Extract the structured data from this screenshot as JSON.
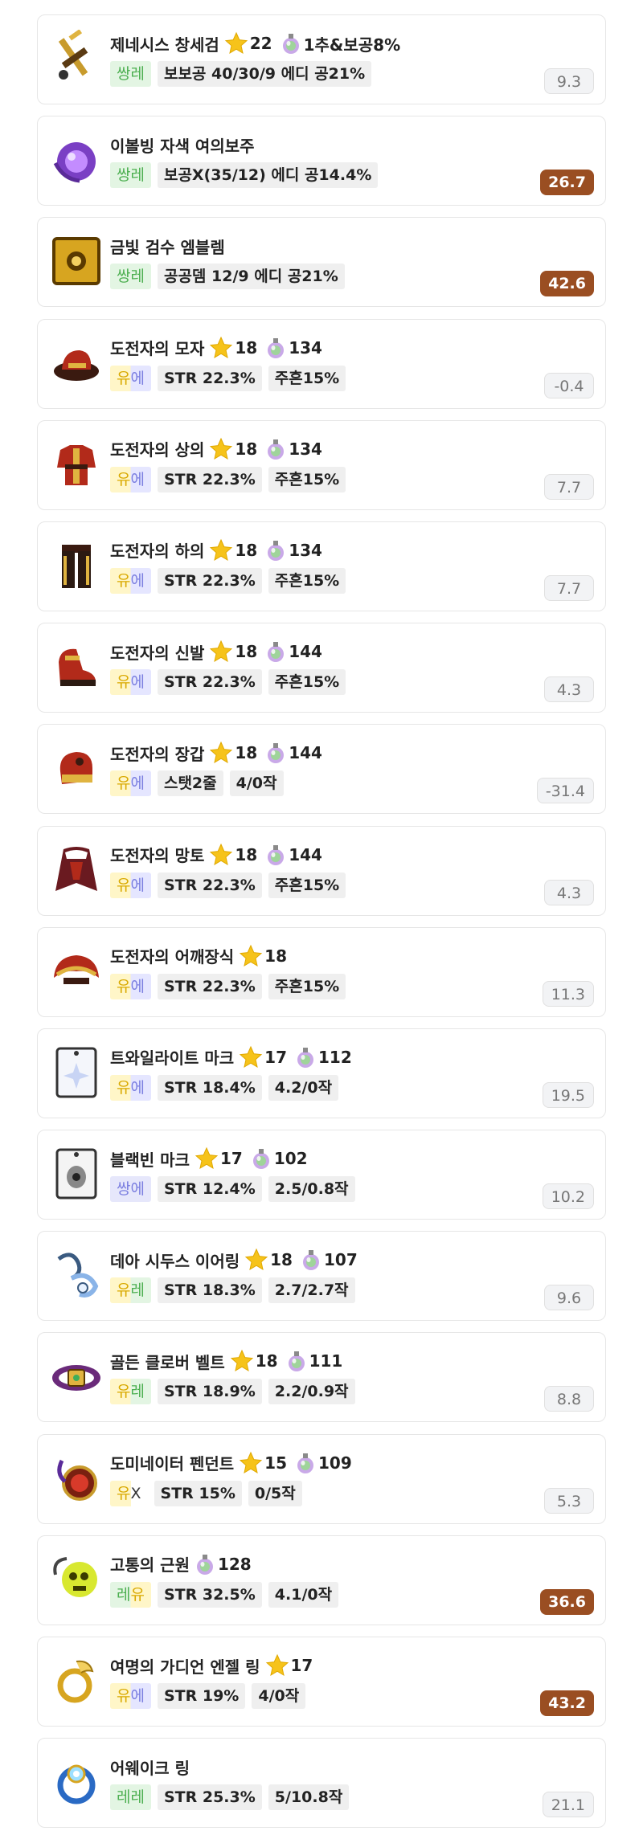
{
  "colors": {
    "score_high_bg": "#9a4e22",
    "score_neutral_bg": "#f2f3f5",
    "star": "#f6c31a"
  },
  "items": [
    {
      "name": "제네시스 창세검",
      "icon": "sword-icon",
      "star": "22",
      "pot": "1추&보공8%",
      "grade": [
        "쌍레"
      ],
      "grade_style": "g-ssangre",
      "stats": [
        "보보공 40/30/9 에디 공21%"
      ],
      "score": "9.3",
      "score_style": "neutral"
    },
    {
      "name": "이볼빙 자색 여의보주",
      "icon": "orb-icon",
      "star": "",
      "pot": "",
      "grade": [
        "쌍레"
      ],
      "grade_style": "g-ssangre",
      "stats": [
        "보공X(35/12) 에디 공14.4%"
      ],
      "score": "26.7",
      "score_style": "high"
    },
    {
      "name": "금빛 검수 엠블렘",
      "icon": "emblem-icon",
      "star": "",
      "pot": "",
      "grade": [
        "쌍레"
      ],
      "grade_style": "g-ssangre",
      "stats": [
        "공공뎀 12/9 에디 공21%"
      ],
      "score": "42.6",
      "score_style": "high"
    },
    {
      "name": "도전자의 모자",
      "icon": "hat-icon",
      "star": "18",
      "pot": "134",
      "grade": [
        "유",
        "에"
      ],
      "grade_style": "g-yue",
      "stats": [
        "STR 22.3%",
        "주흔15%"
      ],
      "score": "-0.4",
      "score_style": "neutral"
    },
    {
      "name": "도전자의 상의",
      "icon": "top-icon",
      "star": "18",
      "pot": "134",
      "grade": [
        "유",
        "에"
      ],
      "grade_style": "g-yue",
      "stats": [
        "STR 22.3%",
        "주흔15%"
      ],
      "score": "7.7",
      "score_style": "neutral"
    },
    {
      "name": "도전자의 하의",
      "icon": "pants-icon",
      "star": "18",
      "pot": "134",
      "grade": [
        "유",
        "에"
      ],
      "grade_style": "g-yue",
      "stats": [
        "STR 22.3%",
        "주흔15%"
      ],
      "score": "7.7",
      "score_style": "neutral"
    },
    {
      "name": "도전자의 신발",
      "icon": "shoes-icon",
      "star": "18",
      "pot": "144",
      "grade": [
        "유",
        "에"
      ],
      "grade_style": "g-yue",
      "stats": [
        "STR 22.3%",
        "주흔15%"
      ],
      "score": "4.3",
      "score_style": "neutral"
    },
    {
      "name": "도전자의 장갑",
      "icon": "gloves-icon",
      "star": "18",
      "pot": "144",
      "grade": [
        "유",
        "에"
      ],
      "grade_style": "g-yue",
      "stats": [
        "스탯2줄",
        "4/0작"
      ],
      "score": "-31.4",
      "score_style": "neutral"
    },
    {
      "name": "도전자의 망토",
      "icon": "cape-icon",
      "star": "18",
      "pot": "144",
      "grade": [
        "유",
        "에"
      ],
      "grade_style": "g-yue",
      "stats": [
        "STR 22.3%",
        "주흔15%"
      ],
      "score": "4.3",
      "score_style": "neutral"
    },
    {
      "name": "도전자의 어깨장식",
      "icon": "shoulder-icon",
      "star": "18",
      "pot": "",
      "grade": [
        "유",
        "에"
      ],
      "grade_style": "g-yue",
      "stats": [
        "STR 22.3%",
        "주흔15%"
      ],
      "score": "11.3",
      "score_style": "neutral"
    },
    {
      "name": "트와일라이트 마크",
      "icon": "mark-icon",
      "star": "17",
      "pot": "112",
      "grade": [
        "유",
        "에"
      ],
      "grade_style": "g-yue",
      "stats": [
        "STR 18.4%",
        "4.2/0작"
      ],
      "score": "19.5",
      "score_style": "neutral"
    },
    {
      "name": "블랙빈 마크",
      "icon": "black-mark-icon",
      "star": "17",
      "pot": "102",
      "grade": [
        "쌍에"
      ],
      "grade_style": "g-ssange",
      "stats": [
        "STR 12.4%",
        "2.5/0.8작"
      ],
      "score": "10.2",
      "score_style": "neutral"
    },
    {
      "name": "데아 시두스 이어링",
      "icon": "earring-icon",
      "star": "18",
      "pot": "107",
      "grade": [
        "유",
        "레"
      ],
      "grade_style": "g-yure",
      "stats": [
        "STR 18.3%",
        "2.7/2.7작"
      ],
      "score": "9.6",
      "score_style": "neutral"
    },
    {
      "name": "골든 클로버 벨트",
      "icon": "belt-icon",
      "star": "18",
      "pot": "111",
      "grade": [
        "유",
        "레"
      ],
      "grade_style": "g-yure",
      "stats": [
        "STR 18.9%",
        "2.2/0.9작"
      ],
      "score": "8.8",
      "score_style": "neutral"
    },
    {
      "name": "도미네이터 펜던트",
      "icon": "pendant-icon",
      "star": "15",
      "pot": "109",
      "grade": [
        "유",
        "X"
      ],
      "grade_style": "g-yux",
      "stats": [
        "STR 15%",
        "0/5작"
      ],
      "score": "5.3",
      "score_style": "neutral"
    },
    {
      "name": "고통의 근원",
      "icon": "skull-icon",
      "star": "",
      "pot": "128",
      "grade": [
        "레",
        "유"
      ],
      "grade_style": "g-reyu",
      "stats": [
        "STR 32.5%",
        "4.1/0작"
      ],
      "score": "36.6",
      "score_style": "high"
    },
    {
      "name": "여명의 가디언 엔젤 링",
      "icon": "ring-icon",
      "star": "17",
      "pot": "",
      "grade": [
        "유",
        "에"
      ],
      "grade_style": "g-yue",
      "stats": [
        "STR 19%",
        "4/0작"
      ],
      "score": "43.2",
      "score_style": "high"
    },
    {
      "name": "어웨이크 링",
      "icon": "awake-ring-icon",
      "star": "",
      "pot": "",
      "grade": [
        "레레"
      ],
      "grade_style": "g-rerre",
      "stats": [
        "STR 25.3%",
        "5/10.8작"
      ],
      "score": "21.1",
      "score_style": "neutral"
    }
  ]
}
